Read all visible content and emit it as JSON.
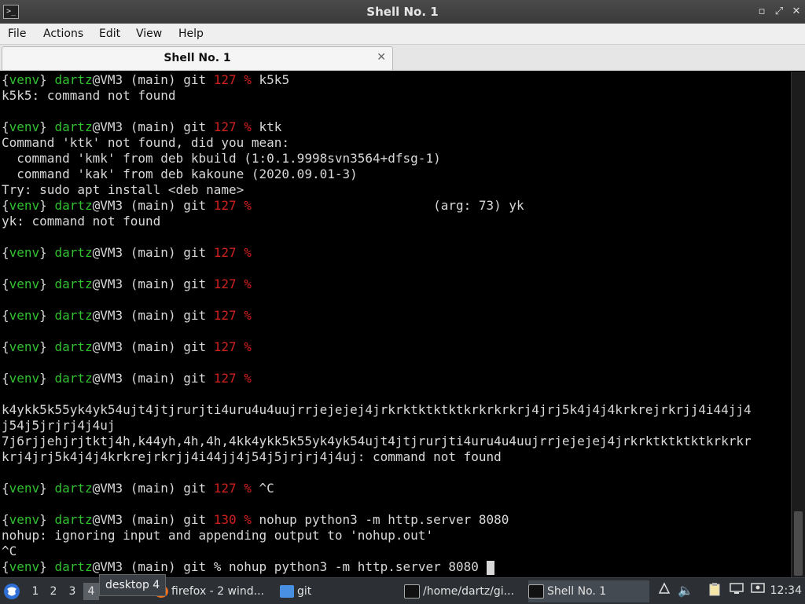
{
  "window": {
    "title": "Shell No. 1",
    "minimize_glyph": "▫",
    "maximize_glyph": "⤢",
    "close_glyph": "✕"
  },
  "menu": {
    "file": "File",
    "actions": "Actions",
    "edit": "Edit",
    "view": "View",
    "help": "Help"
  },
  "tab": {
    "label": "Shell No. 1",
    "close_glyph": "✕"
  },
  "terminal": {
    "lines": [
      [
        {
          "t": "{",
          "c": "w"
        },
        {
          "t": "venv",
          "c": "g"
        },
        {
          "t": "} ",
          "c": "w"
        },
        {
          "t": "dartz",
          "c": "g"
        },
        {
          "t": "@VM3 (main) git ",
          "c": "w"
        },
        {
          "t": "127 %",
          "c": "r"
        },
        {
          "t": " k5k5",
          "c": "w"
        }
      ],
      [
        {
          "t": "k5k5: command not found",
          "c": "w"
        }
      ],
      [],
      [
        {
          "t": "{",
          "c": "w"
        },
        {
          "t": "venv",
          "c": "g"
        },
        {
          "t": "} ",
          "c": "w"
        },
        {
          "t": "dartz",
          "c": "g"
        },
        {
          "t": "@VM3 (main) git ",
          "c": "w"
        },
        {
          "t": "127 %",
          "c": "r"
        },
        {
          "t": " ktk",
          "c": "w"
        }
      ],
      [
        {
          "t": "Command 'ktk' not found, did you mean:",
          "c": "w"
        }
      ],
      [
        {
          "t": "  command 'kmk' from deb kbuild (1:0.1.9998svn3564+dfsg-1)",
          "c": "w"
        }
      ],
      [
        {
          "t": "  command 'kak' from deb kakoune (2020.09.01-3)",
          "c": "w"
        }
      ],
      [
        {
          "t": "Try: sudo apt install <deb name>",
          "c": "w"
        }
      ],
      [
        {
          "t": "{",
          "c": "w"
        },
        {
          "t": "venv",
          "c": "g"
        },
        {
          "t": "} ",
          "c": "w"
        },
        {
          "t": "dartz",
          "c": "g"
        },
        {
          "t": "@VM3 (main) git ",
          "c": "w"
        },
        {
          "t": "127 %",
          "c": "r"
        },
        {
          "t": "                        (arg: 73) yk",
          "c": "w"
        }
      ],
      [
        {
          "t": "yk: command not found",
          "c": "w"
        }
      ],
      [],
      [
        {
          "t": "{",
          "c": "w"
        },
        {
          "t": "venv",
          "c": "g"
        },
        {
          "t": "} ",
          "c": "w"
        },
        {
          "t": "dartz",
          "c": "g"
        },
        {
          "t": "@VM3 (main) git ",
          "c": "w"
        },
        {
          "t": "127 %",
          "c": "r"
        }
      ],
      [],
      [
        {
          "t": "{",
          "c": "w"
        },
        {
          "t": "venv",
          "c": "g"
        },
        {
          "t": "} ",
          "c": "w"
        },
        {
          "t": "dartz",
          "c": "g"
        },
        {
          "t": "@VM3 (main) git ",
          "c": "w"
        },
        {
          "t": "127 %",
          "c": "r"
        }
      ],
      [],
      [
        {
          "t": "{",
          "c": "w"
        },
        {
          "t": "venv",
          "c": "g"
        },
        {
          "t": "} ",
          "c": "w"
        },
        {
          "t": "dartz",
          "c": "g"
        },
        {
          "t": "@VM3 (main) git ",
          "c": "w"
        },
        {
          "t": "127 %",
          "c": "r"
        }
      ],
      [],
      [
        {
          "t": "{",
          "c": "w"
        },
        {
          "t": "venv",
          "c": "g"
        },
        {
          "t": "} ",
          "c": "w"
        },
        {
          "t": "dartz",
          "c": "g"
        },
        {
          "t": "@VM3 (main) git ",
          "c": "w"
        },
        {
          "t": "127 %",
          "c": "r"
        }
      ],
      [],
      [
        {
          "t": "{",
          "c": "w"
        },
        {
          "t": "venv",
          "c": "g"
        },
        {
          "t": "} ",
          "c": "w"
        },
        {
          "t": "dartz",
          "c": "g"
        },
        {
          "t": "@VM3 (main) git ",
          "c": "w"
        },
        {
          "t": "127 %",
          "c": "r"
        }
      ],
      [],
      [
        {
          "t": "k4ykk5k55yk4yk54ujt4jtjrurjti4uru4u4uujrrjejejej4jrkrktktktktkrkrkrkrj4jrj5k4j4j4krkrejrkrjj4i44jj4",
          "c": "w"
        }
      ],
      [
        {
          "t": "j54j5jrjrj4j4uj",
          "c": "w"
        }
      ],
      [
        {
          "t": "7j6rjjehjrjtktj4h,k44yh,4h,4h,4kk4ykk5k55yk4yk54ujt4jtjrurjti4uru4u4uujrrjejejej4jrkrktktktktkrkrkr",
          "c": "w"
        }
      ],
      [
        {
          "t": "krj4jrj5k4j4j4krkrejrkrjj4i44jj4j54j5jrjrj4j4uj: command not found",
          "c": "w"
        }
      ],
      [],
      [
        {
          "t": "{",
          "c": "w"
        },
        {
          "t": "venv",
          "c": "g"
        },
        {
          "t": "} ",
          "c": "w"
        },
        {
          "t": "dartz",
          "c": "g"
        },
        {
          "t": "@VM3 (main) git ",
          "c": "w"
        },
        {
          "t": "127 %",
          "c": "r"
        },
        {
          "t": " ^C",
          "c": "w"
        }
      ],
      [],
      [
        {
          "t": "{",
          "c": "w"
        },
        {
          "t": "venv",
          "c": "g"
        },
        {
          "t": "} ",
          "c": "w"
        },
        {
          "t": "dartz",
          "c": "g"
        },
        {
          "t": "@VM3 (main) git ",
          "c": "w"
        },
        {
          "t": "130 %",
          "c": "r"
        },
        {
          "t": " nohup python3 -m http.server 8080",
          "c": "w"
        }
      ],
      [
        {
          "t": "nohup: ignoring input and appending output to 'nohup.out'",
          "c": "w"
        }
      ],
      [
        {
          "t": "^C",
          "c": "w"
        }
      ],
      [
        {
          "t": "{",
          "c": "w"
        },
        {
          "t": "venv",
          "c": "g"
        },
        {
          "t": "} ",
          "c": "w"
        },
        {
          "t": "dartz",
          "c": "g"
        },
        {
          "t": "@VM3 (main) git % nohup python3 -m http.server 8080 ",
          "c": "w"
        },
        {
          "t": "",
          "c": "cursor"
        }
      ]
    ]
  },
  "taskbar": {
    "workspaces": [
      "1",
      "2",
      "3",
      "4"
    ],
    "active_workspace": "4",
    "tooltip": "desktop 4",
    "tasks": [
      {
        "label": "firefox - 2 wind...",
        "icon": "firefox-icon"
      },
      {
        "label": "git",
        "icon": "folder-icon"
      },
      {
        "label": "/home/dartz/gi...",
        "icon": "terminal-icon"
      },
      {
        "label": "Shell No. 1",
        "icon": "terminal-icon"
      }
    ],
    "clock": "12:34"
  },
  "colors": {
    "prompt_green": "#30c030",
    "status_red": "#d02020",
    "terminal_bg": "#000000",
    "taskbar_bg": "#2c3035"
  }
}
